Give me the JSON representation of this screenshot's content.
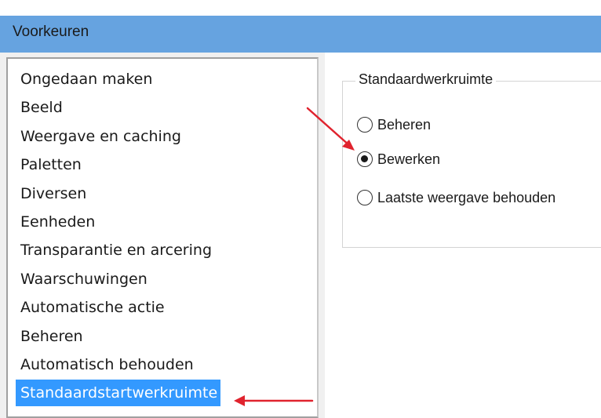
{
  "window": {
    "title": "Voorkeuren"
  },
  "nav": {
    "items": [
      {
        "label": "Ongedaan maken"
      },
      {
        "label": "Beeld"
      },
      {
        "label": "Weergave en caching"
      },
      {
        "label": "Paletten"
      },
      {
        "label": "Diversen"
      },
      {
        "label": "Eenheden"
      },
      {
        "label": "Transparantie en arcering"
      },
      {
        "label": "Waarschuwingen"
      },
      {
        "label": "Automatische actie"
      },
      {
        "label": "Beheren"
      },
      {
        "label": "Automatisch behouden"
      },
      {
        "label": "Standaardstartwerkruimte"
      }
    ],
    "selected": "Standaardstartwerkruimte"
  },
  "workspace_group": {
    "legend": "Standaardwerkruimte",
    "options": [
      {
        "label": "Beheren",
        "checked": false
      },
      {
        "label": "Bewerken",
        "checked": true
      },
      {
        "label": "Laatste weergave behouden",
        "checked": false
      }
    ]
  },
  "colors": {
    "titlebar": "#66a3e0",
    "selection": "#3399ff",
    "annotation_arrow": "#e0232e"
  },
  "icons": {
    "radio_unchecked": "radio-unchecked-icon",
    "radio_checked": "radio-checked-icon",
    "arrow": "red-arrow-icon"
  }
}
